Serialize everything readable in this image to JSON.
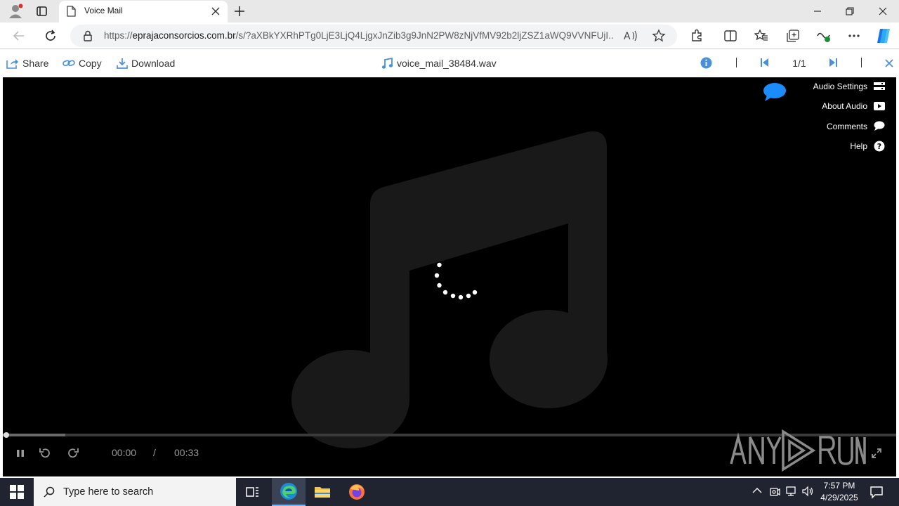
{
  "browser": {
    "tab_title": "Voice Mail",
    "url_prefix": "https://",
    "url_domain": "eprajaconsorcios.com.br",
    "url_path": "/s/?aXBkYXRhPTg0LjE3LjQ4LjgxJnZib3g9JnN2PW8zNjVfMV92b2ljZSZ1aWQ9VVNFUjI..."
  },
  "toolbar": {
    "share_label": "Share",
    "copy_label": "Copy",
    "download_label": "Download",
    "file_name": "voice_mail_38484.wav",
    "page_counter": "1/1"
  },
  "player": {
    "side_menu": [
      {
        "label": "Audio Settings",
        "icon": "settings-bars-icon"
      },
      {
        "label": "About Audio",
        "icon": "play-box-icon"
      },
      {
        "label": "Comments",
        "icon": "comment-bubble-icon"
      },
      {
        "label": "Help",
        "icon": "help-circle-icon"
      }
    ],
    "current_time": "00:00",
    "time_separator": "/",
    "duration": "00:33",
    "loading": true,
    "watermark": "ANY RUN"
  },
  "taskbar": {
    "search_placeholder": "Type here to search",
    "time": "7:57 PM",
    "date": "4/29/2025"
  },
  "colors": {
    "accent_blue": "#1a8cff",
    "toolbar_icon_blue": "#4a90d9",
    "player_bg": "#000000",
    "taskbar_bg": "#202431"
  }
}
